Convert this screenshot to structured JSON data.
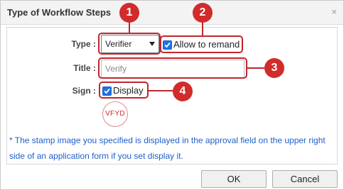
{
  "dialog": {
    "title": "Type of Workflow Steps",
    "close_glyph": "×",
    "close_icon": "close-icon"
  },
  "form": {
    "type_label": "Type :",
    "type_value": "Verifier",
    "allow_remand_label": "Allow to remand",
    "allow_remand_checked": true,
    "title_label": "Title :",
    "title_value": "Verify",
    "sign_label": "Sign :",
    "display_label": "Display",
    "display_checked": true,
    "stamp_text": "VFYD"
  },
  "note": "* The stamp image you specified is displayed in the approval field on the upper right side of an application form if you set display it.",
  "buttons": {
    "ok_label": "OK",
    "cancel_label": "Cancel"
  },
  "callouts": [
    "1",
    "2",
    "3",
    "4"
  ],
  "colors": {
    "callout": "#d12b2b",
    "note_text": "#1f5fc9",
    "checkbox": "#1a73e8"
  }
}
